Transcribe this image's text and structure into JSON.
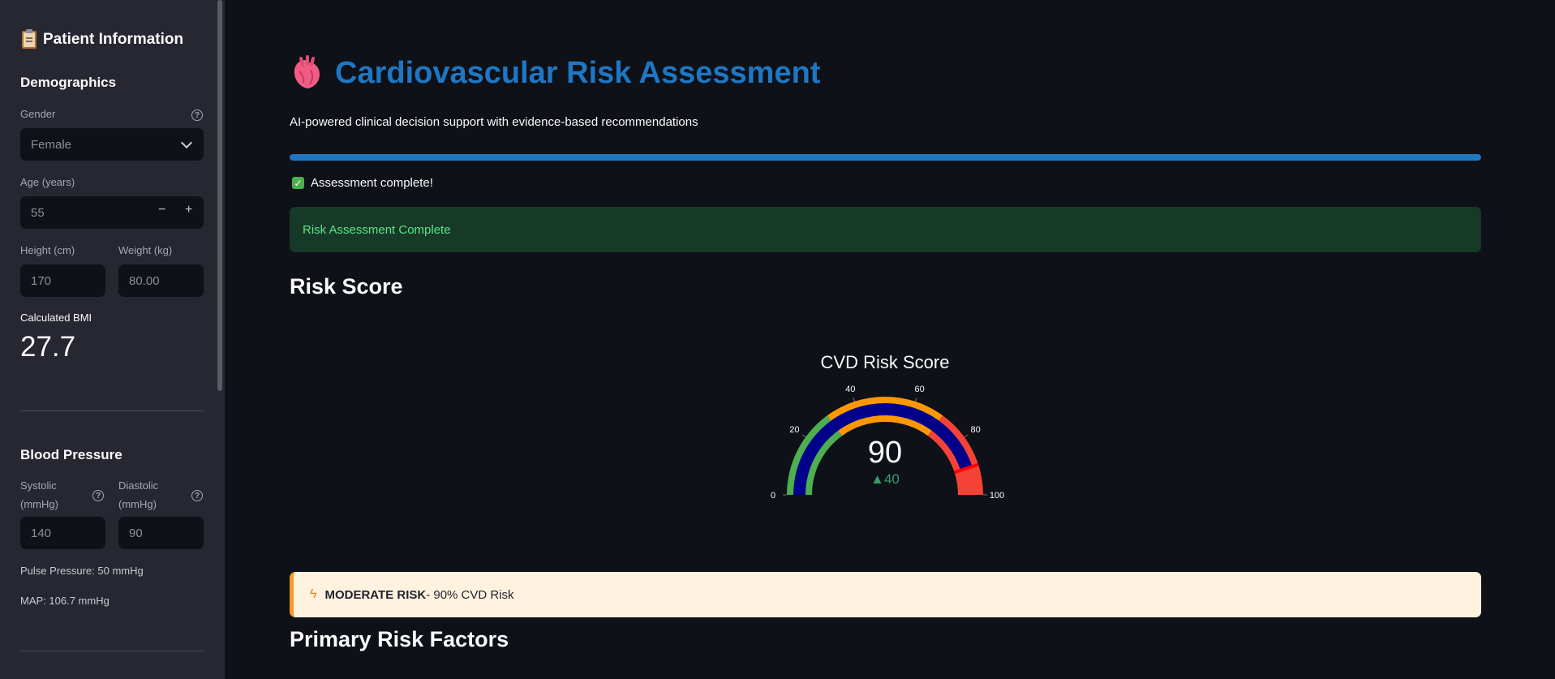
{
  "sidebar": {
    "title": "Patient Information",
    "demographics_heading": "Demographics",
    "gender_label": "Gender",
    "gender_value": "Female",
    "age_label": "Age (years)",
    "age_value": "55",
    "height_label": "Height (cm)",
    "height_value": "170",
    "weight_label": "Weight (kg)",
    "weight_value": "80.00",
    "bmi_label": "Calculated BMI",
    "bmi_value": "27.7",
    "bp_heading": "Blood Pressure",
    "systolic_label_1": "Systolic",
    "systolic_label_2": "(mmHg)",
    "systolic_value": "140",
    "diastolic_label_1": "Diastolic",
    "diastolic_label_2": "(mmHg)",
    "diastolic_value": "90",
    "pulse_pressure": "Pulse Pressure: 50 mmHg",
    "map": "MAP: 106.7 mmHg",
    "minus": "−",
    "plus": "+"
  },
  "main": {
    "title": "Cardiovascular Risk Assessment",
    "subtitle": "AI-powered clinical decision support with evidence-based recommendations",
    "progress": 1.0,
    "complete_text": "Assessment complete!",
    "success_text": "Risk Assessment Complete",
    "risk_score_heading": "Risk Score",
    "primary_factors_heading": "Primary Risk Factors",
    "warning_level": "MODERATE RISK",
    "warning_rest": " - 90% CVD Risk"
  },
  "chart_data": {
    "type": "gauge",
    "title": "CVD Risk Score",
    "value": 90,
    "delta": "▲40",
    "range": [
      0,
      100
    ],
    "ticks": [
      "0",
      "20",
      "40",
      "60",
      "80",
      "100"
    ],
    "steps": [
      {
        "range": [
          0,
          30
        ],
        "color": "#4caf50"
      },
      {
        "range": [
          30,
          70
        ],
        "color": "#ff9800"
      },
      {
        "range": [
          70,
          100
        ],
        "color": "#f44336"
      }
    ],
    "bar_color": "#00008b",
    "threshold": 90,
    "threshold_color": "#ff0000"
  },
  "colors": {
    "accent": "#1f77c4",
    "success": "#5ce488",
    "warning": "#f59a23"
  }
}
